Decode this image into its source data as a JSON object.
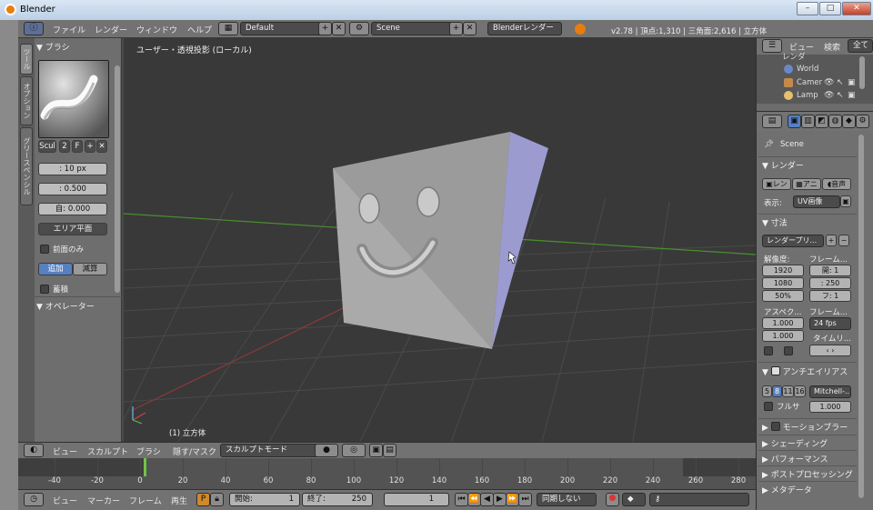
{
  "window": {
    "title": "Blender",
    "controls": [
      "–",
      "□",
      "✕"
    ]
  },
  "topbar": {
    "menus": [
      "ファイル",
      "レンダー",
      "ウィンドウ",
      "ヘルプ"
    ],
    "layout": "Default",
    "scene": "Scene",
    "engine": "Blenderレンダー",
    "info": "v2.78 | 頂点:1,310 | 三角面:2,616 | 立方体"
  },
  "toolshelf": {
    "tabs": [
      "ツール",
      "オプション",
      "グリースペンシル"
    ],
    "brush_header": "▼ ブラシ",
    "brush_name": "Scul",
    "brush_users": "2",
    "brush_fake": "F",
    "radius": ": 10 px",
    "strength": ": 0.500",
    "autosmooth": "自:  0.000",
    "sculpt_plane": "エリア平面",
    "front_faces": "前面のみ",
    "add": "追加",
    "subtract": "減算",
    "accumulate": "蓄積",
    "operator_header": "▼ オペレーター"
  },
  "viewport": {
    "title": "ユーザー・透視投影 (ローカル)",
    "object_label": "(1) 立方体"
  },
  "header3d": {
    "items": [
      "ビュー",
      "スカルプト",
      "ブラシ",
      "隠す/マスク"
    ],
    "mode": "スカルプトモード"
  },
  "timeline": {
    "ticks": [
      "-40",
      "-20",
      "0",
      "20",
      "40",
      "60",
      "80",
      "100",
      "120",
      "140",
      "160",
      "180",
      "200",
      "220",
      "240",
      "260",
      "280"
    ]
  },
  "bottombar": {
    "items": [
      "ビュー",
      "マーカー",
      "フレーム",
      "再生"
    ],
    "start": "開始:",
    "start_val": "1",
    "end": "終了:",
    "end_val": "250",
    "current": "1",
    "sync": "同期しない"
  },
  "outliner": {
    "menus": [
      "ビュー",
      "検索"
    ],
    "all_label": "全て",
    "rows": [
      "レンダ",
      "World",
      "Camer",
      "Lamp"
    ]
  },
  "properties": {
    "scene": "Scene",
    "render_section": "▼ レンダー",
    "render_btn": "レン",
    "anim_btn": "アニ",
    "audio_btn": "音声",
    "display_label": "表示:",
    "display_value": "UV画像",
    "dimensions": "▼ 寸法",
    "preset": "レンダープリ...",
    "resolution": "解像度:",
    "res_x": "1920",
    "res_y": "1080",
    "res_pct": "50%",
    "frame_range": "フレーム...",
    "frame_start": "開:  1",
    "frame_end": ":  250",
    "frame_step": "フ:  1",
    "aspect": "アスペク...",
    "asp_x": "1.000",
    "asp_y": "1.000",
    "frame_rate": "フレーム...",
    "fps": "24 fps",
    "time_remap": "タイムリ...",
    "aa": "アンチエイリアス",
    "aa_samples": [
      "5",
      "8",
      "11",
      "16"
    ],
    "aa_filter": "Mitchell-...",
    "full_sample": "フルサ",
    "filter_size": "1.000",
    "motion_blur": "モーションブラー",
    "sections": [
      "▶ シェーディング",
      "▶ パフォーマンス",
      "▶ ポストプロセッシング",
      "▶ メタデータ"
    ]
  }
}
